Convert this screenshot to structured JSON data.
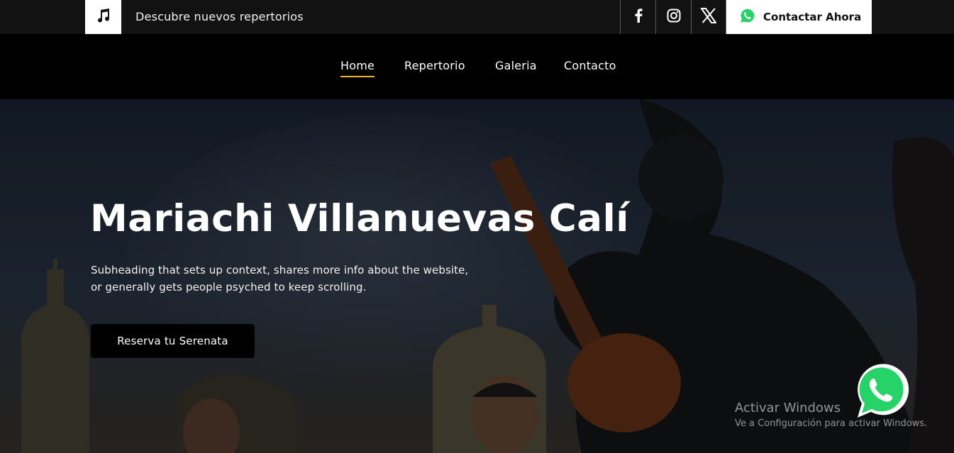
{
  "topbar": {
    "tagline": "Descubre nuevos repertorios",
    "music_icon": "music-note-icon",
    "social": [
      "facebook-icon",
      "instagram-icon",
      "x-twitter-icon"
    ],
    "contact_label": "Contactar Ahora",
    "contact_icon": "whatsapp-icon"
  },
  "nav": {
    "items": [
      {
        "label": "Home",
        "active": true
      },
      {
        "label": "Repertorio",
        "active": false
      },
      {
        "label": "Galeria",
        "active": false
      },
      {
        "label": "Contacto",
        "active": false
      }
    ]
  },
  "hero": {
    "title": "Mariachi Villanuevas Calí",
    "subheading_line1": "Subheading that sets up context, shares more info about the website,",
    "subheading_line2": "or generally gets people psyched to keep scrolling.",
    "cta_label": "Reserva tu Serenata"
  },
  "watermark": {
    "title": "Activar Windows",
    "subtitle": "Ve a Configuración para activar Windows."
  },
  "colors": {
    "accent": "#f1b51c",
    "whatsapp": "#25d366",
    "topbar_bg": "#121212",
    "nav_bg": "#000000"
  }
}
